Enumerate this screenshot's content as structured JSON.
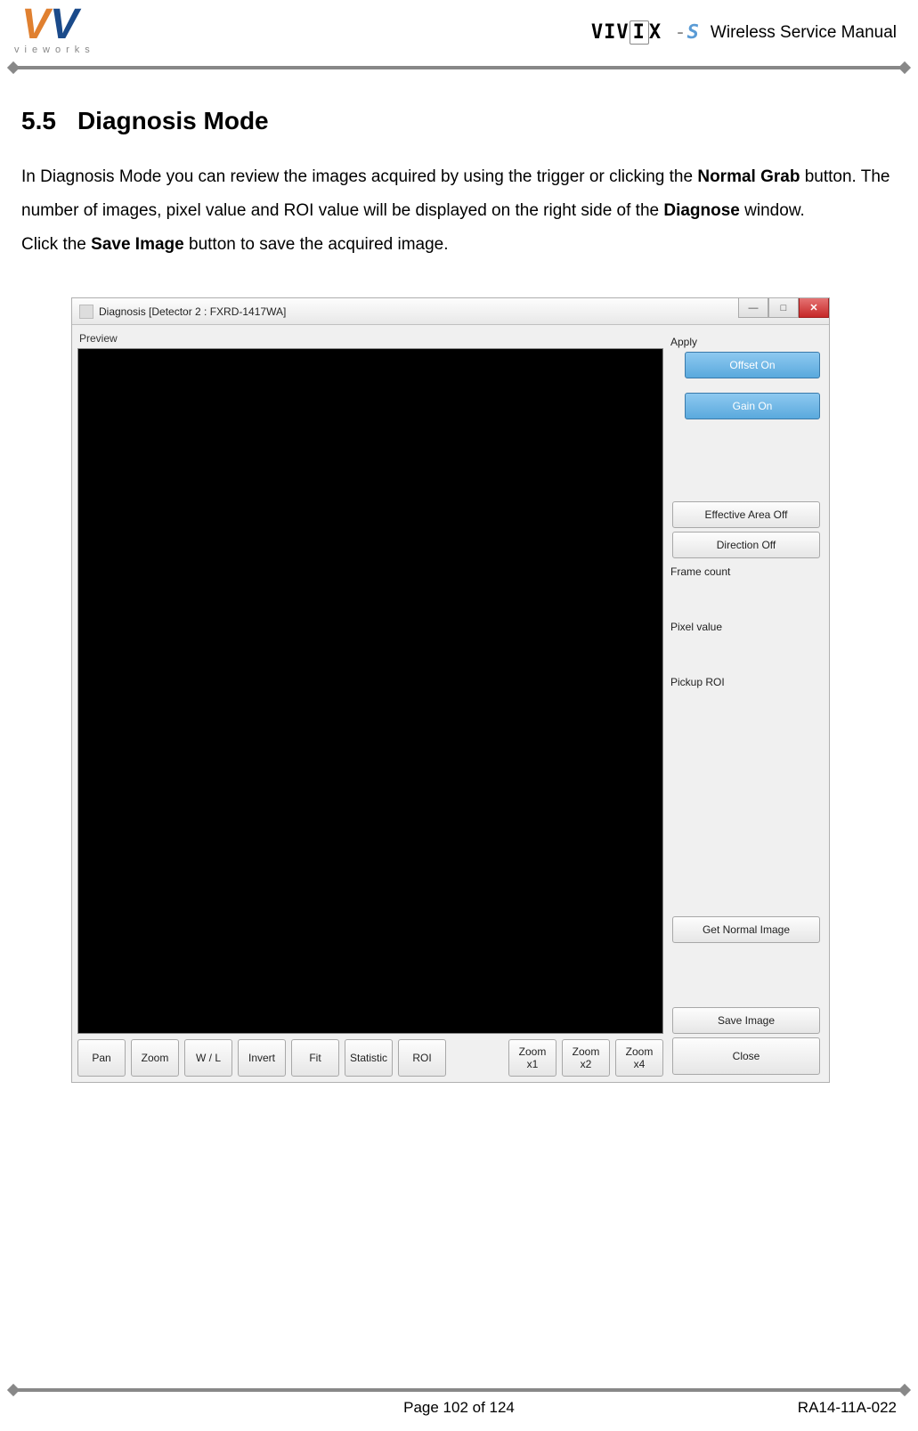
{
  "header": {
    "logo_left_sub": "vieworks",
    "logo_right_text": "VIVIX",
    "logo_right_suffix": "-S",
    "doc_title": "Wireless Service Manual"
  },
  "section": {
    "number": "5.5",
    "title": "Diagnosis Mode"
  },
  "body": {
    "p1_a": "In Diagnosis Mode you can review the images acquired by using the trigger or clicking the ",
    "p1_b": "Normal Grab",
    "p1_c": " button. The number of images, pixel value and ROI value will be displayed on the right side of the ",
    "p1_d": "Diagnose",
    "p1_e": " window.",
    "p2_a": "Click the ",
    "p2_b": "Save Image",
    "p2_c": " button to save the acquired image."
  },
  "screenshot": {
    "window_title": "Diagnosis [Detector 2 : FXRD-1417WA]",
    "min_glyph": "—",
    "max_glyph": "□",
    "close_glyph": "✕",
    "preview_label": "Preview",
    "apply_label": "Apply",
    "btn_offset_on": "Offset On",
    "btn_gain_on": "Gain On",
    "btn_effective_area_off": "Effective Area Off",
    "btn_direction_off": "Direction Off",
    "label_frame_count": "Frame count",
    "label_pixel_value": "Pixel value",
    "label_pickup_roi": "Pickup ROI",
    "btn_get_normal_image": "Get Normal Image",
    "btn_save_image": "Save Image",
    "btn_close": "Close",
    "toolbar": {
      "pan": "Pan",
      "zoom": "Zoom",
      "wl": "W / L",
      "invert": "Invert",
      "fit": "Fit",
      "statistic": "Statistic",
      "roi": "ROI",
      "zoom_x1": "Zoom\nx1",
      "zoom_x2": "Zoom\nx2",
      "zoom_x4": "Zoom\nx4"
    }
  },
  "footer": {
    "page": "Page 102 of 124",
    "doc_id": "RA14-11A-022"
  }
}
